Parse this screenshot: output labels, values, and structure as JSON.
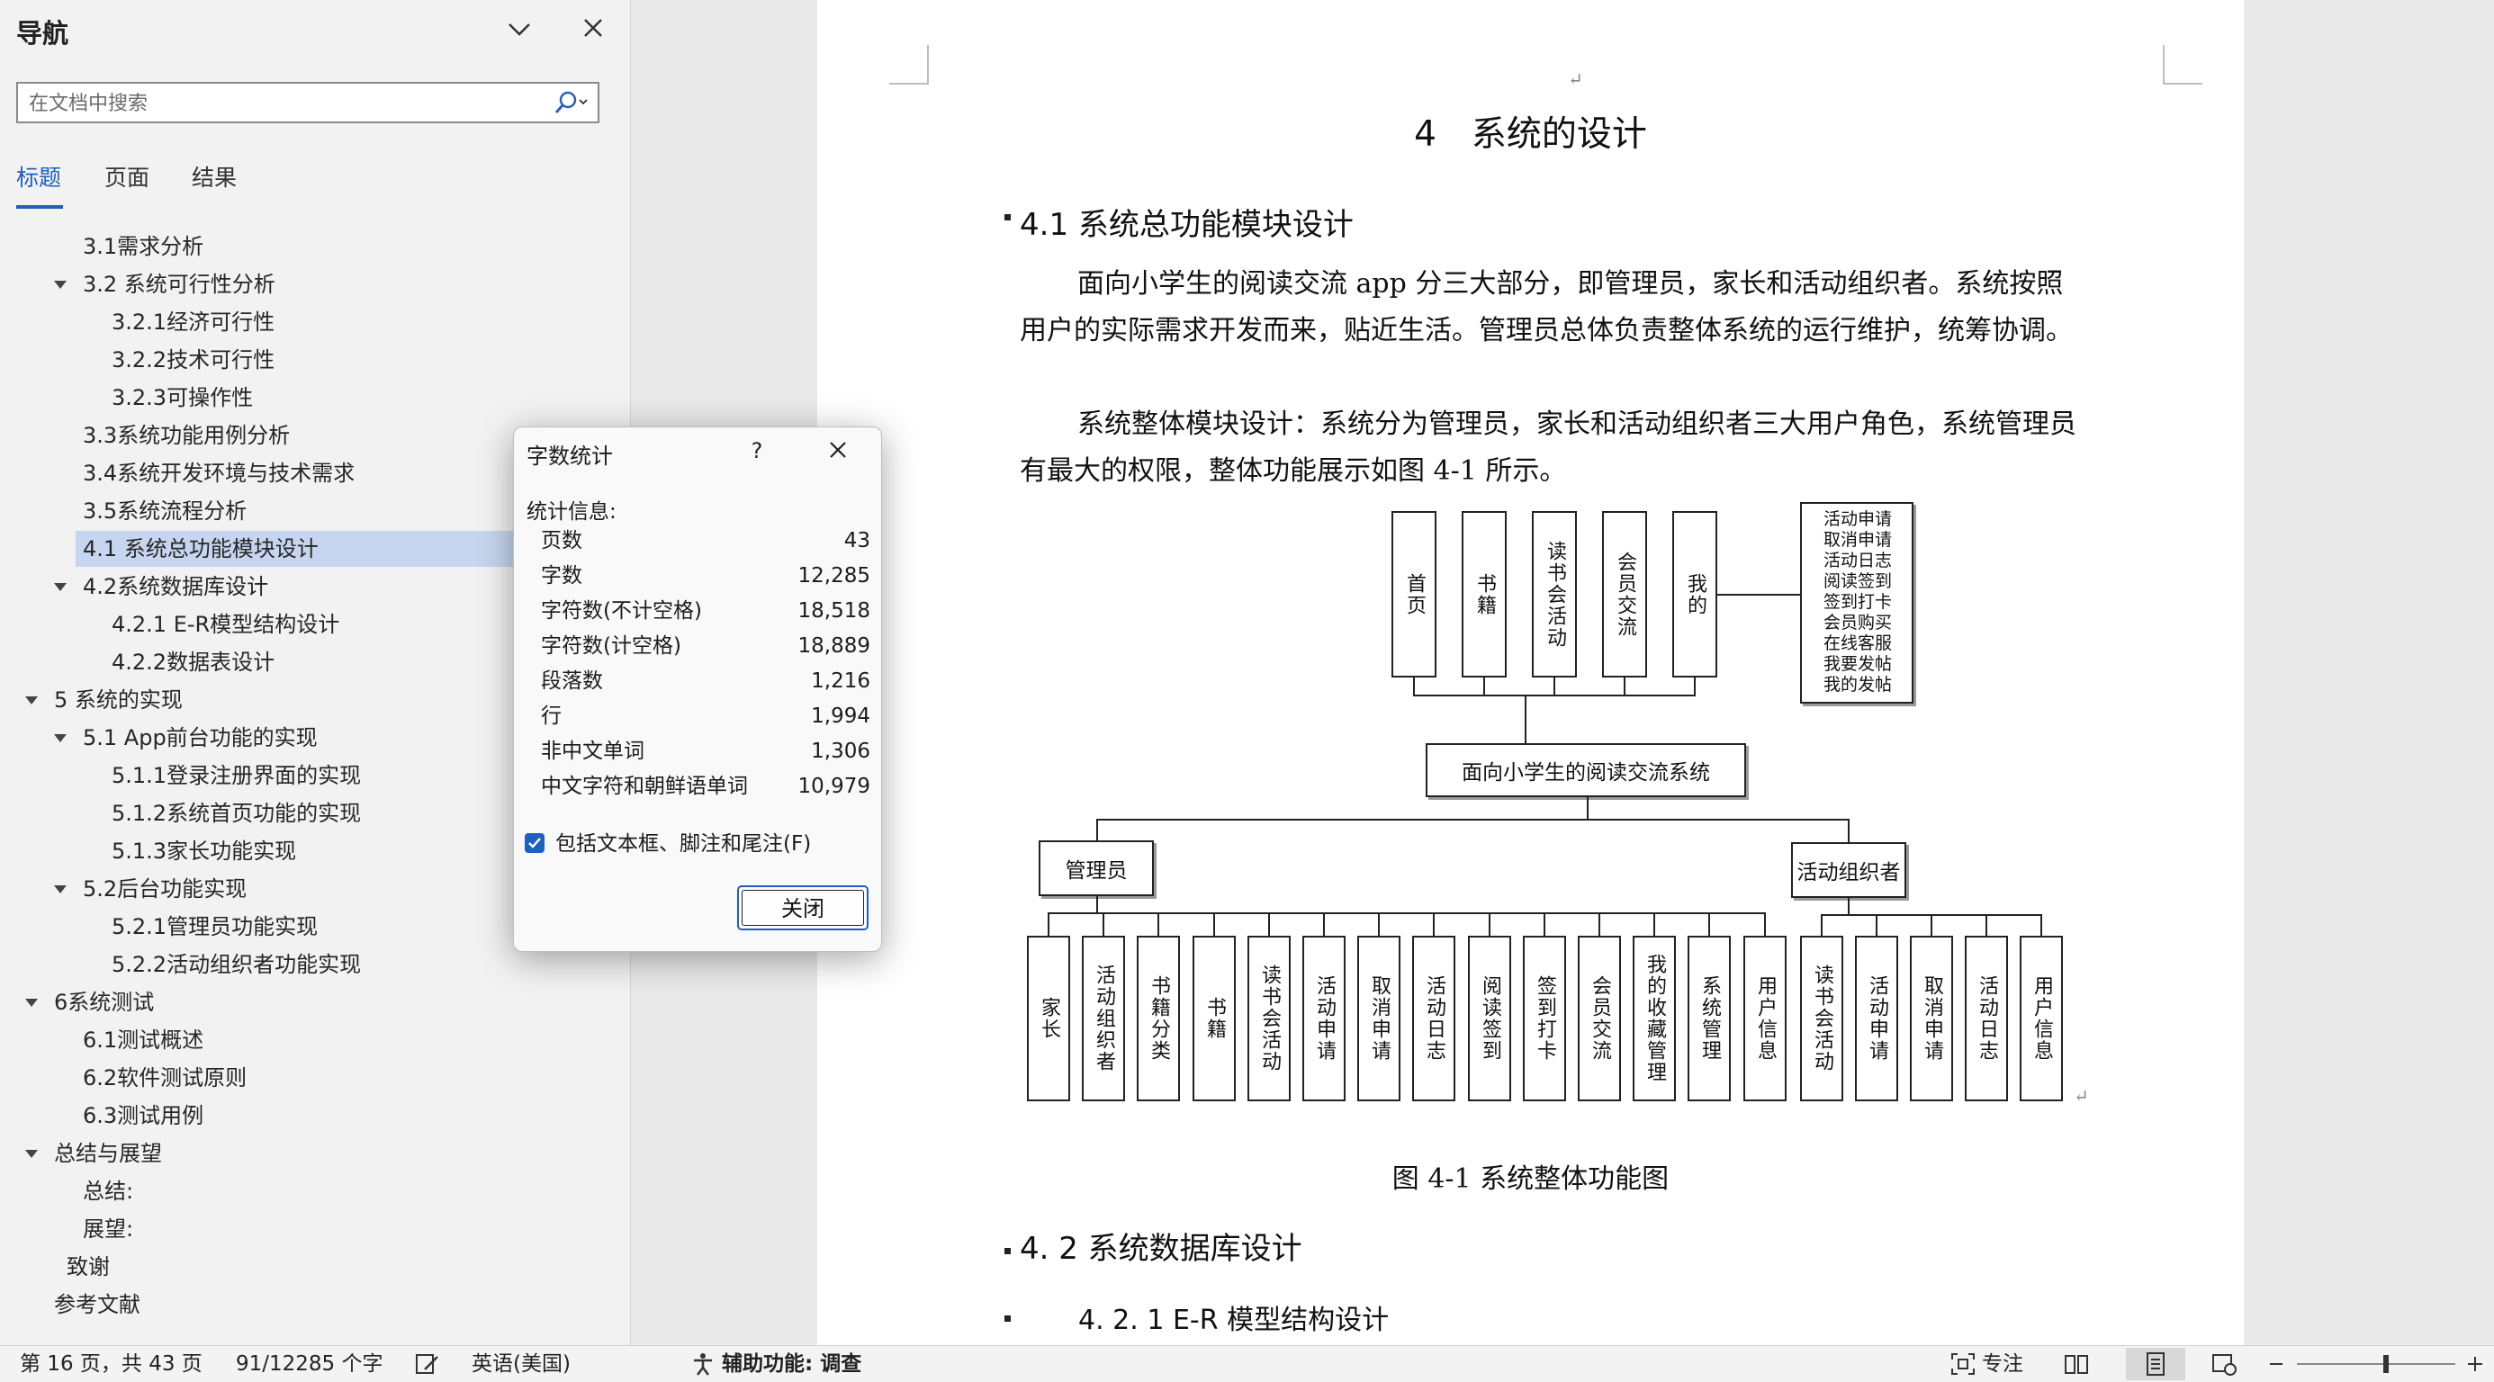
{
  "nav": {
    "title": "导航",
    "search_placeholder": "在文档中搜索",
    "tabs": [
      {
        "label": "标题",
        "active": true
      },
      {
        "label": "页面",
        "active": false
      },
      {
        "label": "结果",
        "active": false
      }
    ],
    "outline": [
      {
        "label": "3.1需求分析",
        "level": 2,
        "caret": false,
        "selected": false
      },
      {
        "label": "3.2 系统可行性分析",
        "level": 2,
        "caret": true,
        "selected": false
      },
      {
        "label": "3.2.1经济可行性",
        "level": 3,
        "caret": false,
        "selected": false
      },
      {
        "label": "3.2.2技术可行性",
        "level": 3,
        "caret": false,
        "selected": false
      },
      {
        "label": "3.2.3可操作性",
        "level": 3,
        "caret": false,
        "selected": false
      },
      {
        "label": "3.3系统功能用例分析",
        "level": 2,
        "caret": false,
        "selected": false
      },
      {
        "label": "3.4系统开发环境与技术需求",
        "level": 2,
        "caret": false,
        "selected": false
      },
      {
        "label": "3.5系统流程分析",
        "level": 2,
        "caret": false,
        "selected": false
      },
      {
        "label": "4.1 系统总功能模块设计",
        "level": 2,
        "caret": false,
        "selected": true
      },
      {
        "label": "4.2系统数据库设计",
        "level": 2,
        "caret": true,
        "selected": false
      },
      {
        "label": "4.2.1 E-R模型结构设计",
        "level": 3,
        "caret": false,
        "selected": false
      },
      {
        "label": "4.2.2数据表设计",
        "level": 3,
        "caret": false,
        "selected": false
      },
      {
        "label": "5 系统的实现",
        "level": 1,
        "caret": true,
        "selected": false
      },
      {
        "label": "5.1 App前台功能的实现",
        "level": 2,
        "caret": true,
        "selected": false
      },
      {
        "label": "5.1.1登录注册界面的实现",
        "level": 3,
        "caret": false,
        "selected": false
      },
      {
        "label": "5.1.2系统首页功能的实现",
        "level": 3,
        "caret": false,
        "selected": false
      },
      {
        "label": "5.1.3家长功能实现",
        "level": 3,
        "caret": false,
        "selected": false
      },
      {
        "label": "5.2后台功能实现",
        "level": 2,
        "caret": true,
        "selected": false
      },
      {
        "label": "5.2.1管理员功能实现",
        "level": 3,
        "caret": false,
        "selected": false
      },
      {
        "label": "5.2.2活动组织者功能实现",
        "level": 3,
        "caret": false,
        "selected": false
      },
      {
        "label": "6系统测试",
        "level": 1,
        "caret": true,
        "selected": false
      },
      {
        "label": "6.1测试概述",
        "level": 2,
        "caret": false,
        "selected": false
      },
      {
        "label": "6.2软件测试原则",
        "level": 2,
        "caret": false,
        "selected": false
      },
      {
        "label": "6.3测试用例",
        "level": 2,
        "caret": false,
        "selected": false
      },
      {
        "label": "总结与展望",
        "level": 1,
        "caret": true,
        "selected": false
      },
      {
        "label": "总结:",
        "level": 2,
        "caret": false,
        "selected": false
      },
      {
        "label": "展望:",
        "level": 2,
        "caret": false,
        "selected": false
      },
      {
        "label": "致谢",
        "level": 1.5,
        "caret": false,
        "selected": false
      },
      {
        "label": "参考文献",
        "level": 1,
        "caret": false,
        "selected": false
      }
    ]
  },
  "document": {
    "chapter_title": "4　系统的设计",
    "section_41": "4.1  系统总功能模块设计",
    "para1": "面向小学生的阅读交流 app 分三大部分，即管理员，家长和活动组织者。系统按照用户的实际需求开发而来，贴近生活。管理员总体负责整体系统的运行维护，统筹协调。",
    "para2": "系统整体模块设计：系统分为管理员，家长和活动组织者三大用户角色，系统管理员有最大的权限，整体功能展示如图 4-1 所示。",
    "figure_caption": "图 4-1  系统整体功能图",
    "section_42": "4. 2 系统数据库设计",
    "section_421": "4. 2. 1  E-R 模型结构设计",
    "paragraph_mark": "↵",
    "diagram": {
      "top_modules": [
        "首页",
        "书籍",
        "读书会活动",
        "会员交流",
        "我的"
      ],
      "side_list": [
        "活动申请",
        "取消申请",
        "活动日志",
        "阅读签到",
        "签到打卡",
        "会员购买",
        "在线客服",
        "我要发帖",
        "我的发帖"
      ],
      "center": "面向小学生的阅读交流系统",
      "admin": "管理员",
      "organizer": "活动组织者",
      "admin_children": [
        "家长",
        "活动组织者",
        "书籍分类",
        "书籍",
        "读书会活动",
        "活动申请",
        "取消申请",
        "活动日志",
        "阅读签到",
        "签到打卡",
        "会员交流",
        "我的收藏管理",
        "系统管理",
        "用户信息"
      ],
      "organizer_children": [
        "读书会活动",
        "活动申请",
        "取消申请",
        "活动日志",
        "用户信息"
      ]
    }
  },
  "dialog": {
    "title": "字数统计",
    "help": "?",
    "stats_label": "统计信息:",
    "stats": [
      {
        "label": "页数",
        "value": "43"
      },
      {
        "label": "字数",
        "value": "12,285"
      },
      {
        "label": "字符数(不计空格)",
        "value": "18,518"
      },
      {
        "label": "字符数(计空格)",
        "value": "18,889"
      },
      {
        "label": "段落数",
        "value": "1,216"
      },
      {
        "label": "行",
        "value": "1,994"
      },
      {
        "label": "非中文单词",
        "value": "1,306"
      },
      {
        "label": "中文字符和朝鲜语单词",
        "value": "10,979"
      }
    ],
    "checkbox_label": "包括文本框、脚注和尾注(F)",
    "checkbox_checked": true,
    "close_label": "关闭"
  },
  "statusbar": {
    "page": "第 16 页，共 43 页",
    "words": "91/12285 个字",
    "language": "英语(美国)",
    "accessibility": "辅助功能: 调查",
    "focus": "专注"
  },
  "colors": {
    "accent": "#1f5fbf",
    "selected": "#c7d6f0"
  }
}
